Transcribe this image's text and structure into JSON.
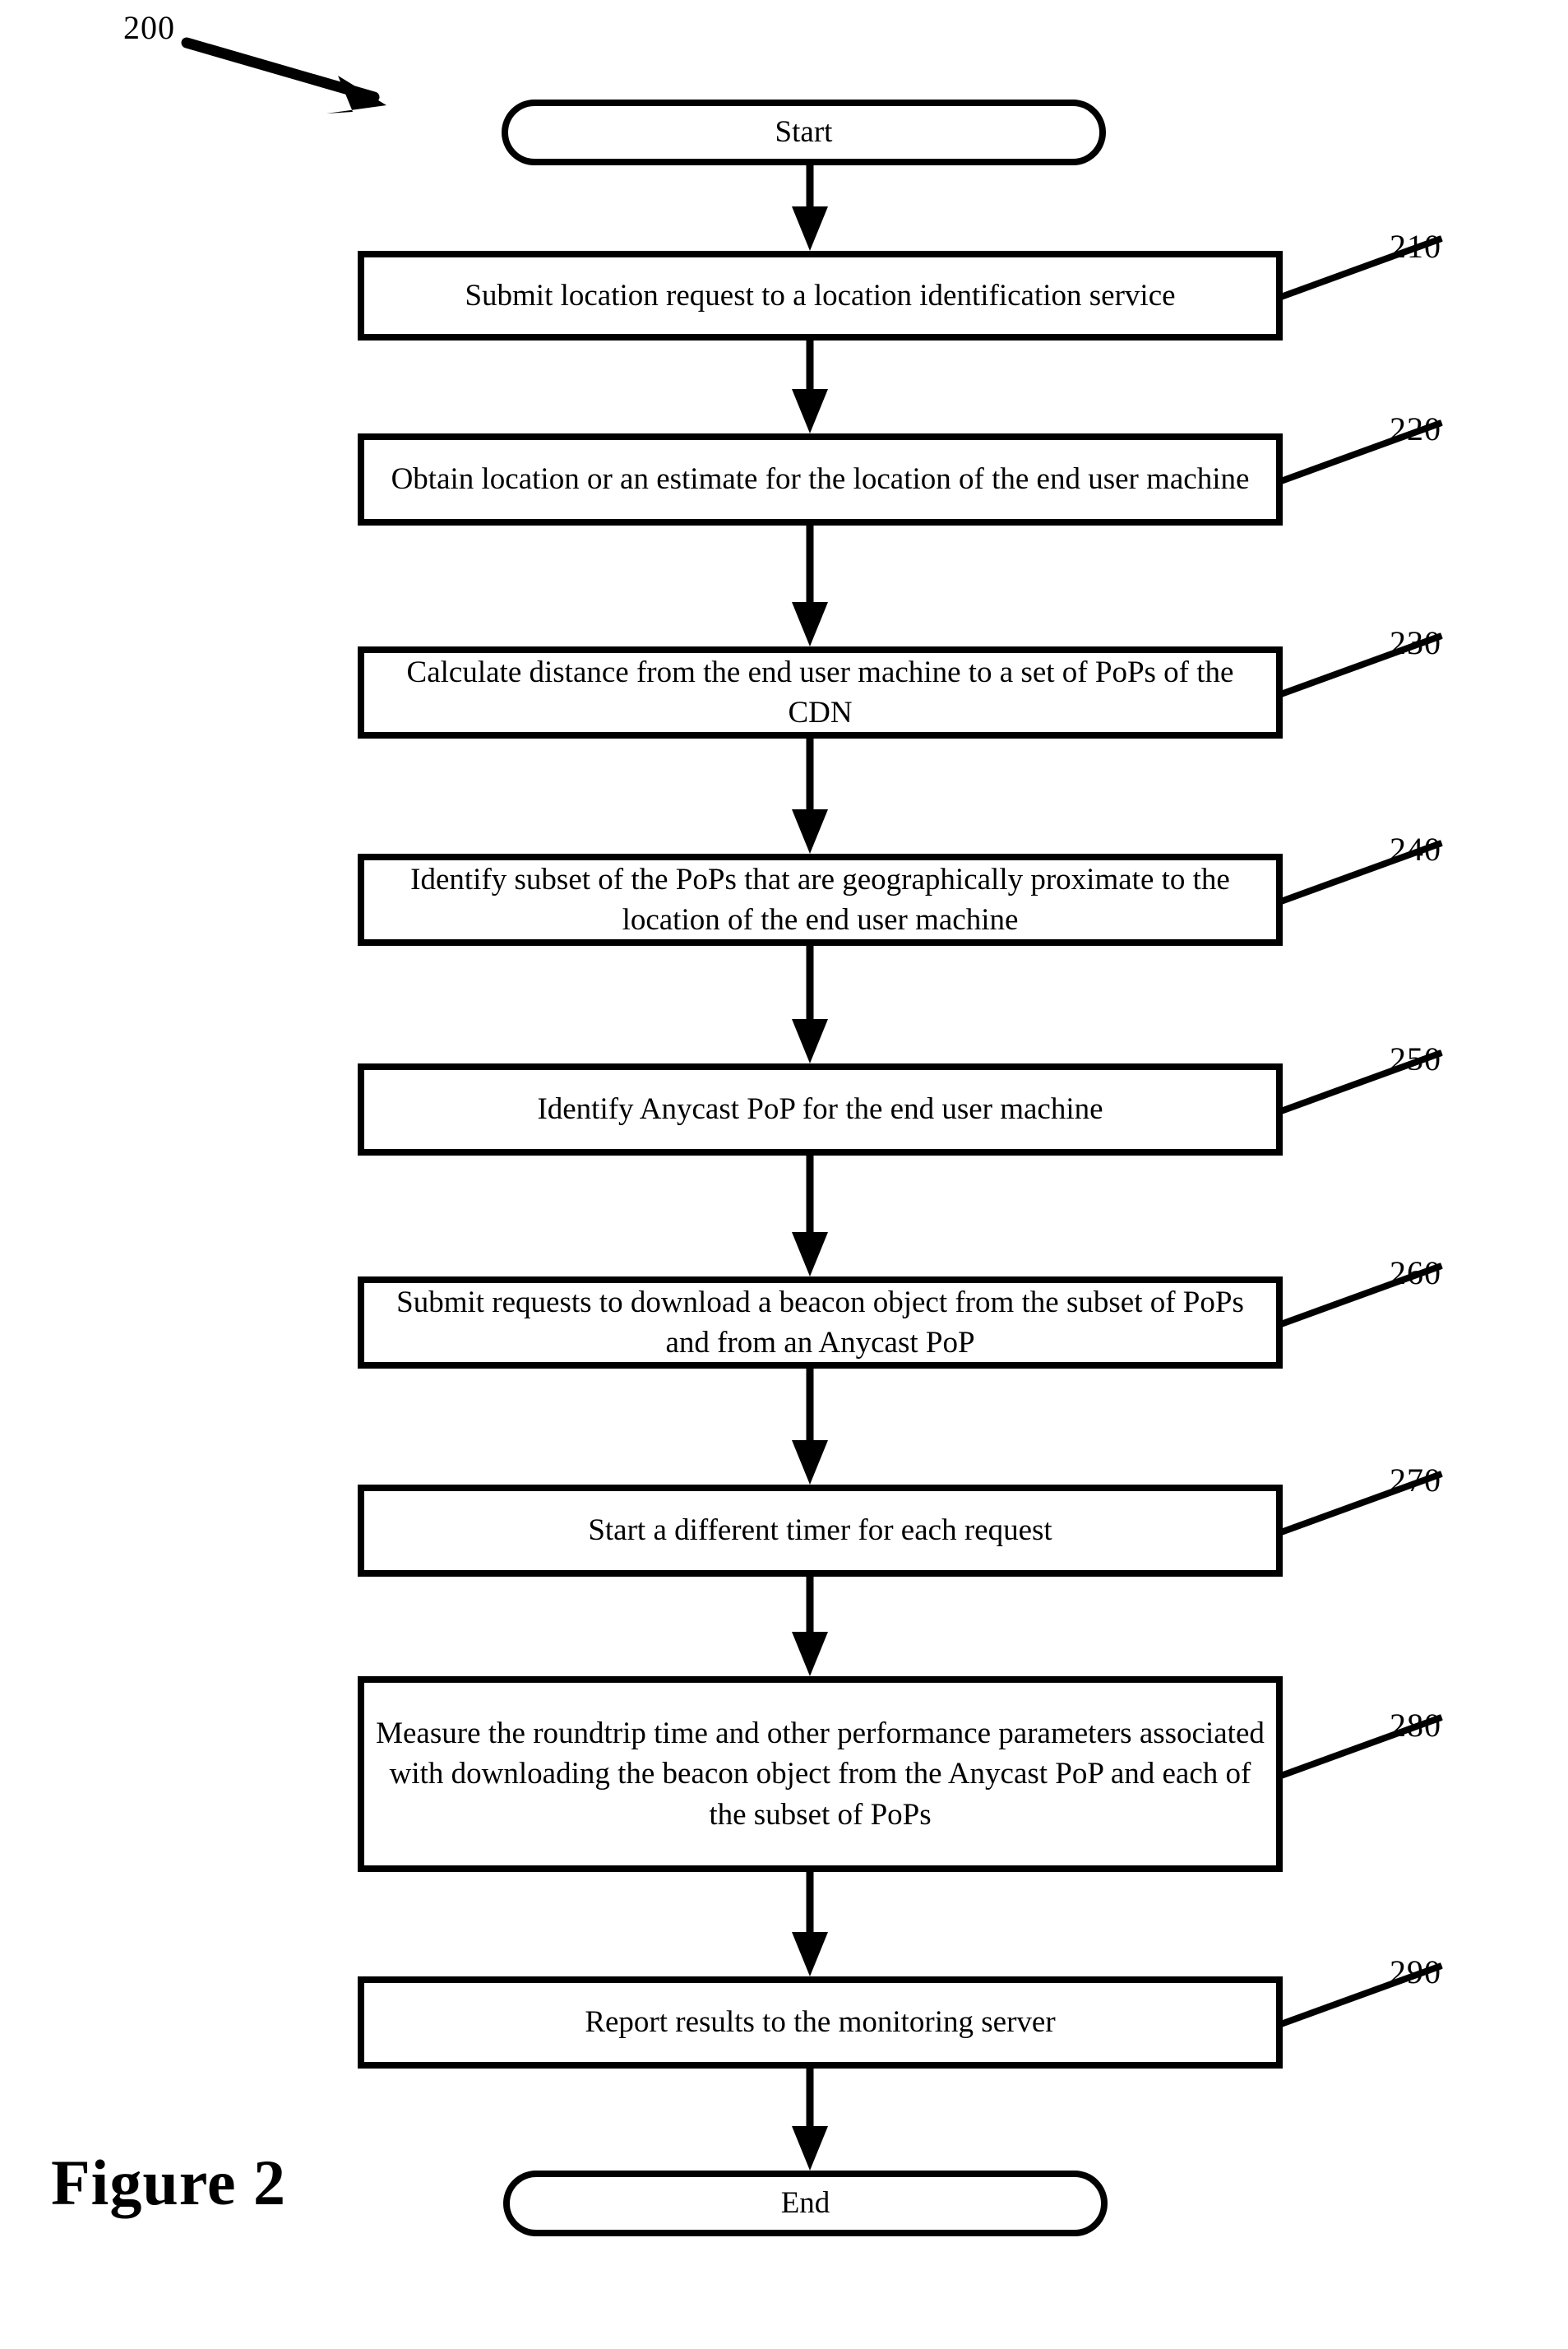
{
  "figure": {
    "caption": "Figure 2",
    "diagram_number": "200"
  },
  "flowchart": {
    "start": {
      "label": "Start"
    },
    "end": {
      "label": "End"
    },
    "steps": [
      {
        "ref": "210",
        "text": "Submit location request to a location identification service"
      },
      {
        "ref": "220",
        "text": "Obtain location or an estimate for the location of the end user machine"
      },
      {
        "ref": "230",
        "text": "Calculate distance from the end user machine to a set of PoPs of the CDN"
      },
      {
        "ref": "240",
        "text": "Identify subset of the PoPs that are geographically proximate to the location of the end user machine"
      },
      {
        "ref": "250",
        "text": "Identify Anycast PoP for the end user machine"
      },
      {
        "ref": "260",
        "text": "Submit requests to download a beacon object from the subset of PoPs and from an Anycast PoP"
      },
      {
        "ref": "270",
        "text": "Start a different timer for each request"
      },
      {
        "ref": "280",
        "text": "Measure the roundtrip time and other performance parameters associated with downloading the beacon object from the Anycast PoP and each of the subset of PoPs"
      },
      {
        "ref": "290",
        "text": "Report results to the monitoring server"
      }
    ]
  },
  "colors": {
    "stroke": "#000000",
    "background": "#ffffff"
  }
}
